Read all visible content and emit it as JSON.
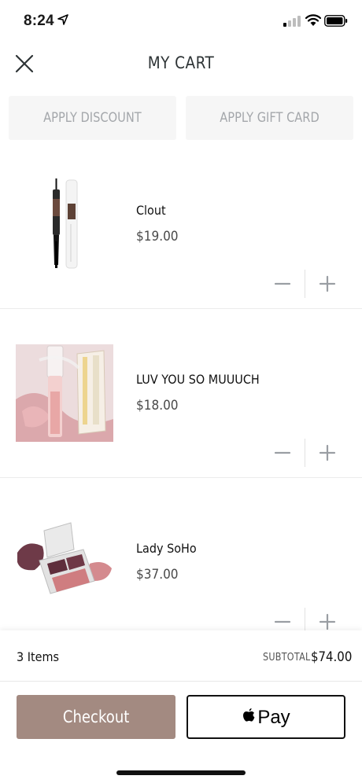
{
  "status_bar": {
    "time": "8:24"
  },
  "header": {
    "title": "MY CART"
  },
  "actions": {
    "discount_label": "APPLY DISCOUNT",
    "gift_card_label": "APPLY GIFT CARD"
  },
  "cart": {
    "items": [
      {
        "name": "Clout",
        "price": "$19.00",
        "image": "mascara-duo-product"
      },
      {
        "name": "LUV YOU SO MUUUCH",
        "price": "$18.00",
        "image": "lip-gloss-kit-product"
      },
      {
        "name": "Lady SoHo",
        "price": "$37.00",
        "image": "eyeshadow-compact-product"
      }
    ],
    "quantity_controls": {
      "minus_icon": "minus-icon",
      "plus_icon": "plus-icon"
    }
  },
  "summary": {
    "items_count": "3 Items",
    "subtotal_label": "SUBTOTAL",
    "subtotal_value": "$74.00"
  },
  "checkout": {
    "checkout_label": "Checkout",
    "applepay_label": "Pay"
  },
  "colors": {
    "checkout_bg": "#a38a81",
    "action_bg": "#f6f6f6",
    "action_text": "#a4a7ab"
  }
}
